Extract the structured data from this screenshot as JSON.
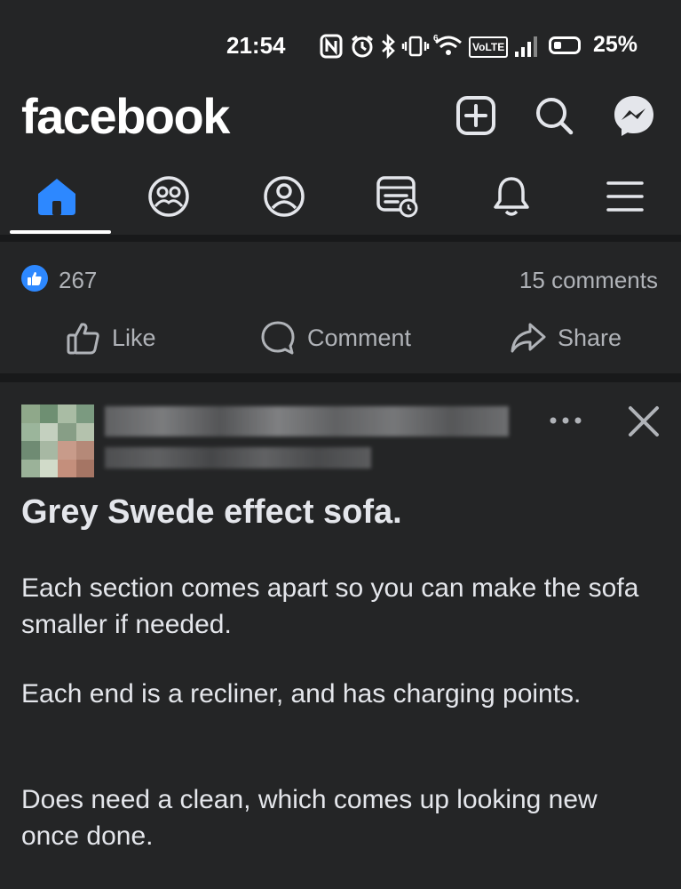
{
  "status_bar": {
    "time": "21:54",
    "battery_text": "25%",
    "icons": [
      "nfc-icon",
      "alarm-icon",
      "bluetooth-icon",
      "vibrate-icon",
      "wifi-icon",
      "volte-icon",
      "signal-icon",
      "battery-icon"
    ],
    "volte_label": "VoLTE"
  },
  "header": {
    "logo_text": "facebook",
    "buttons": [
      "create-post",
      "search",
      "messenger"
    ]
  },
  "nav": {
    "tabs": [
      "home",
      "friends",
      "profile",
      "video",
      "notifications",
      "menu"
    ],
    "active": "home",
    "accent": "#2d88ff"
  },
  "post_stats": {
    "likes": "267",
    "comments": "15 comments"
  },
  "actions": {
    "like": "Like",
    "comment": "Comment",
    "share": "Share"
  },
  "post": {
    "title": "Grey Swede effect sofa.",
    "paragraphs": [
      "Each section comes apart so you can make the sofa smaller if needed.",
      "Each end is a recliner, and has charging points.",
      "Does need a clean, which comes up looking new once done."
    ]
  }
}
